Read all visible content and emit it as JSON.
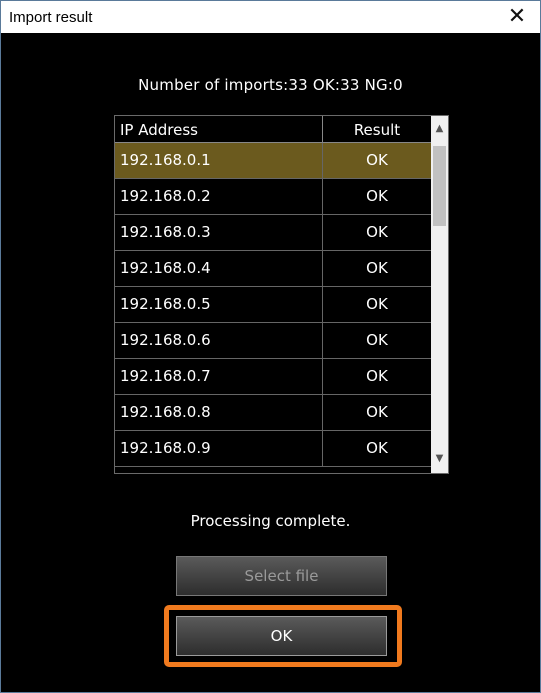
{
  "window": {
    "title": "Import result",
    "close_glyph": "✕"
  },
  "summary": "Number of imports:33  OK:33  NG:0",
  "table": {
    "columns": [
      "IP Address",
      "Result"
    ],
    "rows": [
      {
        "ip": "192.168.0.1",
        "result": "OK",
        "selected": true
      },
      {
        "ip": "192.168.0.2",
        "result": "OK"
      },
      {
        "ip": "192.168.0.3",
        "result": "OK"
      },
      {
        "ip": "192.168.0.4",
        "result": "OK"
      },
      {
        "ip": "192.168.0.5",
        "result": "OK"
      },
      {
        "ip": "192.168.0.6",
        "result": "OK"
      },
      {
        "ip": "192.168.0.7",
        "result": "OK"
      },
      {
        "ip": "192.168.0.8",
        "result": "OK"
      },
      {
        "ip": "192.168.0.9",
        "result": "OK"
      }
    ],
    "scroll_up_glyph": "▲",
    "scroll_down_glyph": "▼"
  },
  "status": "Processing complete.",
  "buttons": {
    "select_file": "Select file",
    "ok": "OK"
  },
  "colors": {
    "selected_row": "#6b5a1e",
    "highlight_border": "#f07a1e",
    "background": "#000000"
  }
}
